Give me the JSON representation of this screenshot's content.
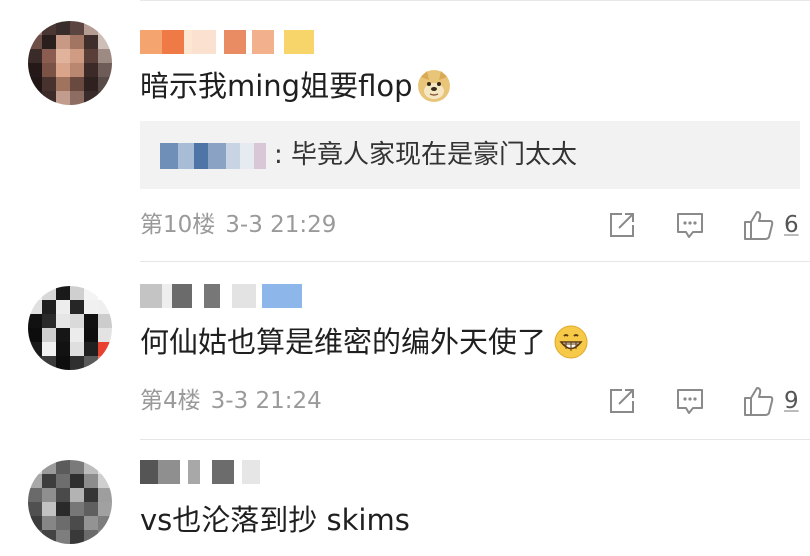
{
  "comments": [
    {
      "text": "暗示我ming姐要flop",
      "reply": {
        "prefix": ": ",
        "text": "毕竟人家现在是豪门太太"
      },
      "floor": "第10楼",
      "time": "3-3 21:29",
      "likes": "6",
      "emoji": "doge-emoji"
    },
    {
      "text": "何仙姑也算是维密的编外天使了",
      "floor": "第4楼",
      "time": "3-3 21:24",
      "likes": "9",
      "emoji": "grin-emoji"
    },
    {
      "text": "vs也沦落到抄 skims"
    }
  ],
  "icons": {
    "share": "share-icon",
    "reply": "comment-icon",
    "like": "thumbs-up-icon"
  },
  "colors": {
    "meta_gray": "#9a9a9a",
    "icon_gray": "#8a8a8a",
    "reply_bg": "#f2f2f2"
  }
}
